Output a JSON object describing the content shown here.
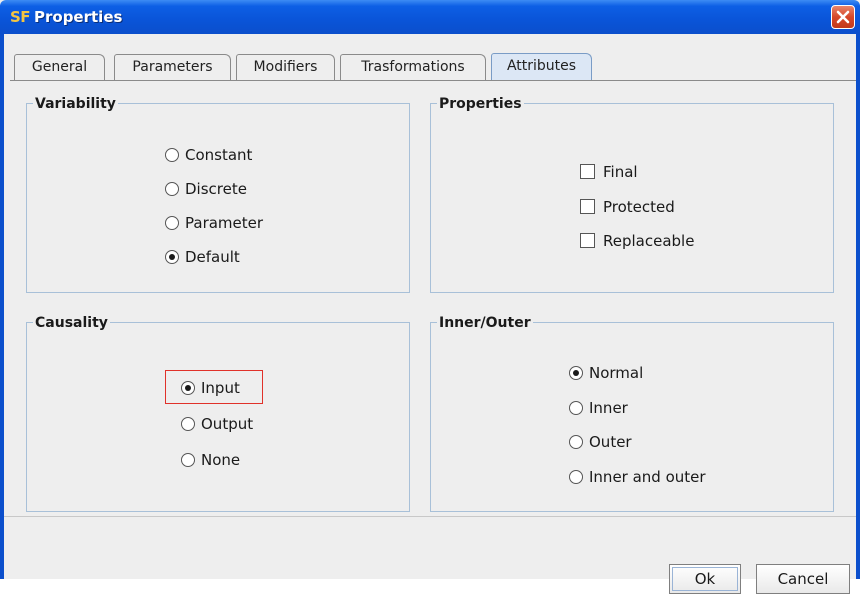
{
  "window": {
    "logo_text": "SF",
    "title": "Properties"
  },
  "tabs": [
    {
      "label": "General",
      "active": false
    },
    {
      "label": "Parameters",
      "active": false
    },
    {
      "label": "Modifiers",
      "active": false
    },
    {
      "label": "Trasformations",
      "active": false
    },
    {
      "label": "Attributes",
      "active": true
    }
  ],
  "variability": {
    "title": "Variability",
    "options": [
      {
        "label": "Constant",
        "checked": false
      },
      {
        "label": "Discrete",
        "checked": false
      },
      {
        "label": "Parameter",
        "checked": false
      },
      {
        "label": "Default",
        "checked": true
      }
    ]
  },
  "properties": {
    "title": "Properties",
    "options": [
      {
        "label": "Final",
        "checked": false
      },
      {
        "label": "Protected",
        "checked": false
      },
      {
        "label": "Replaceable",
        "checked": false
      }
    ]
  },
  "causality": {
    "title": "Causality",
    "options": [
      {
        "label": "Input",
        "checked": true
      },
      {
        "label": "Output",
        "checked": false
      },
      {
        "label": "None",
        "checked": false
      }
    ],
    "highlight_color": "#e0312a"
  },
  "inner_outer": {
    "title": "Inner/Outer",
    "options": [
      {
        "label": "Normal",
        "checked": true
      },
      {
        "label": "Inner",
        "checked": false
      },
      {
        "label": "Outer",
        "checked": false
      },
      {
        "label": "Inner and outer",
        "checked": false
      }
    ]
  },
  "buttons": {
    "ok": "Ok",
    "cancel": "Cancel"
  },
  "colors": {
    "titlebar": "#0b4fcc",
    "active_tab": "#dce7f5",
    "group_border": "#a8c0d8",
    "close_button": "#d6472a"
  }
}
